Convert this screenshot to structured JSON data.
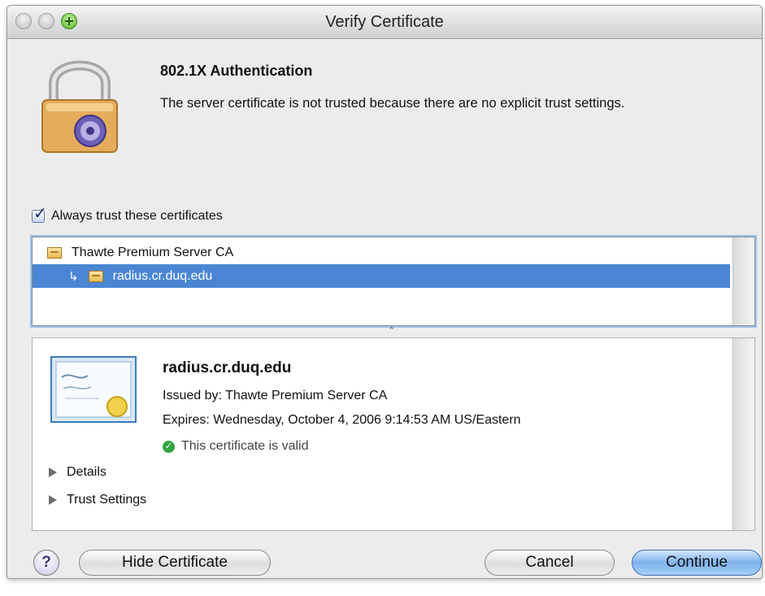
{
  "window": {
    "title": "Verify Certificate"
  },
  "header": {
    "heading": "802.1X Authentication",
    "message": "The server certificate is not trusted because there are no explicit trust settings."
  },
  "trust": {
    "checkbox_label": "Always trust these certificates",
    "checked": true
  },
  "certificate_list": {
    "items": [
      {
        "label": "Thawte Premium Server CA",
        "level": 0,
        "selected": false
      },
      {
        "label": "radius.cr.duq.edu",
        "level": 1,
        "selected": true
      }
    ]
  },
  "details": {
    "cert_name": "radius.cr.duq.edu",
    "issued_by": "Issued by: Thawte Premium Server CA",
    "expires": "Expires: Wednesday, October 4, 2006 9:14:53 AM US/Eastern",
    "valid_text": "This certificate is valid",
    "disclosures": [
      {
        "label": "Details"
      },
      {
        "label": "Trust Settings"
      }
    ]
  },
  "buttons": {
    "help": "?",
    "hide_certificate": "Hide Certificate",
    "cancel": "Cancel",
    "continue": "Continue"
  },
  "colors": {
    "selection": "#4a86d4",
    "default_button": "#7fb2ef",
    "valid_green": "#33a340"
  }
}
